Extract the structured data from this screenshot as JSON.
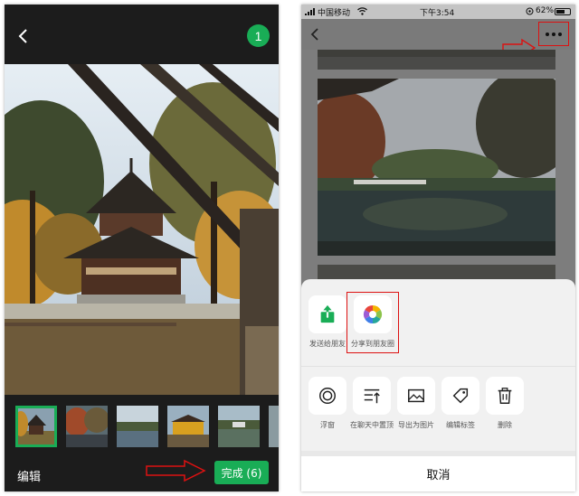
{
  "left_screen": {
    "selected_count": "1",
    "edit_label": "编辑",
    "done_label": "完成 (6)",
    "thumbnails": [
      "pagoda",
      "autumn-trees",
      "lake-reflection",
      "pavilion",
      "lake-pavilion",
      "partial"
    ]
  },
  "right_screen": {
    "status_bar": {
      "carrier": "中国移动",
      "time": "下午3:54",
      "battery": "62%"
    },
    "share_actions": [
      {
        "label": "发送给朋友",
        "icon": "share-up-icon"
      },
      {
        "label": "分享到朋友圈",
        "icon": "moments-aperture-icon"
      }
    ],
    "more_actions": [
      {
        "label": "浮窗",
        "icon": "float-window-icon"
      },
      {
        "label": "在聊天中置顶",
        "icon": "pin-top-icon"
      },
      {
        "label": "导出为图片",
        "icon": "image-export-icon"
      },
      {
        "label": "编辑标签",
        "icon": "tag-icon"
      },
      {
        "label": "删除",
        "icon": "trash-icon"
      }
    ],
    "cancel_label": "取消"
  },
  "colors": {
    "wechat_green": "#19ad56",
    "annotation_red": "#dd1111"
  }
}
